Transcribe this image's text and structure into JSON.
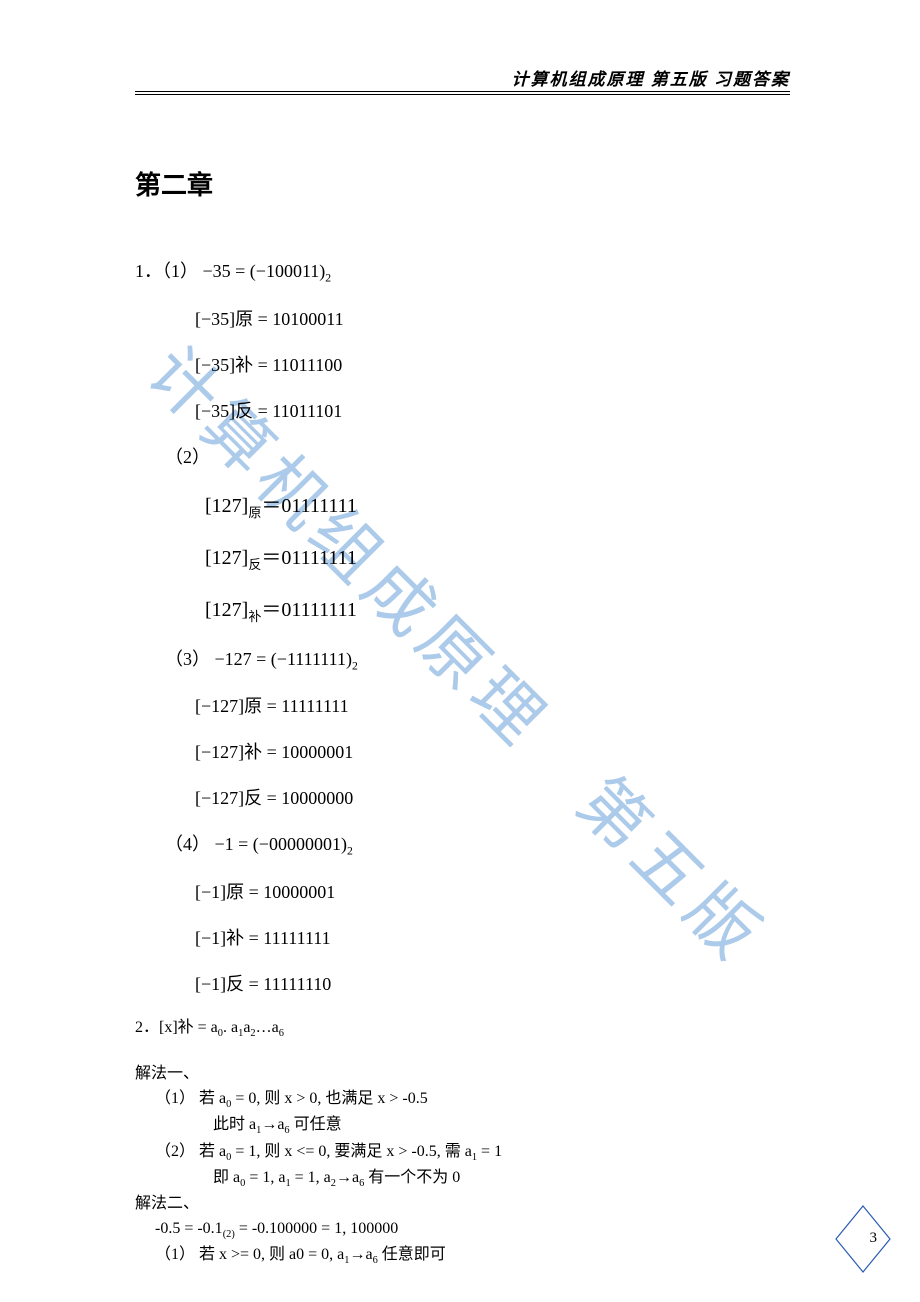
{
  "header": "计算机组成原理  第五版  习题答案",
  "chapter_title": "第二章",
  "watermark": "计算机组成原理　第五版",
  "page_number": "3",
  "q1": {
    "p1": {
      "lead": "1．（1）",
      "expr": "−35 = (−100011)",
      "base": "2",
      "yuan": "[−35]原 = 10100011",
      "bu": "[−35]补 = 11011100",
      "fan": "[−35]反 = 11011101"
    },
    "p2": {
      "lead": "（2）",
      "yuan": "[127]",
      "yuan_sub": "原",
      "yuan_eq": "＝01111111",
      "fan": "[127]",
      "fan_sub": "反",
      "fan_eq": "＝01111111",
      "bu": "[127]",
      "bu_sub": "补",
      "bu_eq": "＝01111111"
    },
    "p3": {
      "lead": "（3）",
      "expr": "−127 = (−1111111)",
      "base": "2",
      "yuan": "[−127]原 = 11111111",
      "bu": "[−127]补 = 10000001",
      "fan": "[−127]反 = 10000000"
    },
    "p4": {
      "lead": "（4）",
      "expr": "−1 = (−00000001)",
      "base": "2",
      "yuan": "[−1]原 = 10000001",
      "bu": "[−1]补 = 11111111",
      "fan": "[−1]反 = 11111110"
    }
  },
  "q2": {
    "head_a": "2．[x]补  = a",
    "s0": "0",
    "head_b": ". a",
    "s1": "1",
    "head_c": "a",
    "s2": "2",
    "head_d": "…a",
    "s6": "6",
    "m1_title": "解法一、",
    "m1_l1a": "（1）   若 a",
    "m1_l1b": " = 0,  则 x > 0,  也满足 x > -0.5",
    "m1_l2a": "此时 a",
    "m1_l2b": "→a",
    "m1_l2c": " 可任意",
    "m1_l3a": "（2）   若 a",
    "m1_l3b": " = 1,  则 x <= 0,  要满足 x > -0.5,  需 a",
    "m1_l3c": " = 1",
    "m1_l4a": "即 a",
    "m1_l4b": " = 1, a",
    "m1_l4c": " = 1, a",
    "m1_l4d": "→a",
    "m1_l4e": " 有一个不为 0",
    "m2_title": "解法二、",
    "m2_l1a": "-0.5 = -0.1",
    "m2_l1sub": "(2)",
    "m2_l1b": " = -0.100000 = 1, 100000",
    "m2_l2a": "（1）   若 x >= 0,  则 a0 = 0, a",
    "m2_l2b": "→a",
    "m2_l2c": " 任意即可"
  }
}
